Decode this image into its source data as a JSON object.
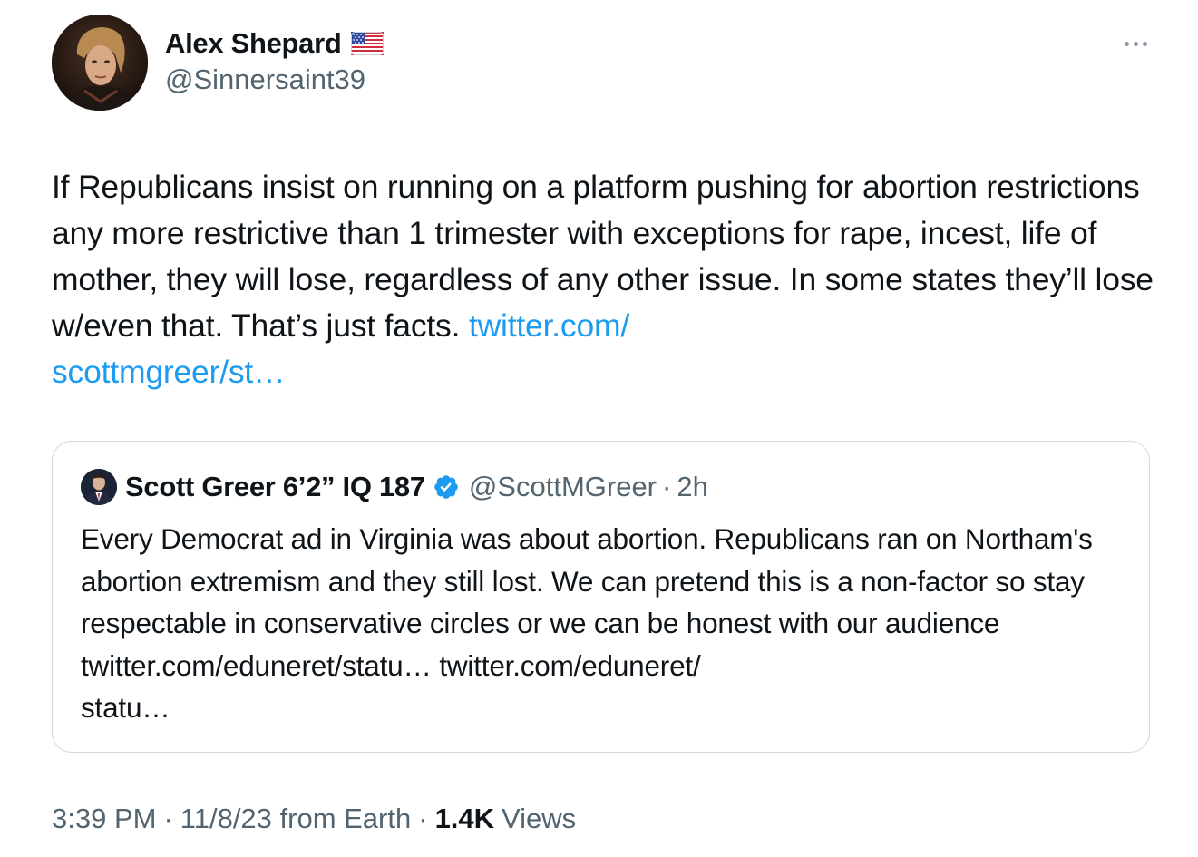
{
  "author": {
    "display_name": "Alex Shepard",
    "flag_icon": "us-flag-icon",
    "handle": "@Sinnersaint39"
  },
  "more_icon": "more-dots-icon",
  "tweet": {
    "text": "If Republicans insist on running on a platform pushing for abortion restrictions any more restrictive than 1 trimester with exceptions for rape, incest, life of mother, they will lose, regardless of any other issue. In some states they’ll lose w/even that. That’s just facts. ",
    "link": "twitter.com/\nscottmgreer/st…"
  },
  "quoted_tweet": {
    "display_name": "Scott Greer 6’2” IQ 187",
    "verified_icon": "verified-badge-icon",
    "handle": "@ScottMGreer",
    "separator": "·",
    "time": "2h",
    "text": "Every Democrat ad in Virginia was about abortion. Republicans ran on Northam's abortion extremism and they still lost. We can pretend this is a non-factor so stay respectable in conservative circles or we can be honest with our audience twitter.com/eduneret/statu… twitter.com/eduneret/\nstatu…"
  },
  "meta": {
    "time": "3:39 PM",
    "date": "11/8/23 from Earth",
    "separator": "·",
    "views_count": "1.4K",
    "views_label": "Views"
  },
  "colors": {
    "link": "#1d9bf0",
    "secondary_text": "#536471",
    "border": "#cfd9de",
    "verified": "#1d9bf0"
  }
}
